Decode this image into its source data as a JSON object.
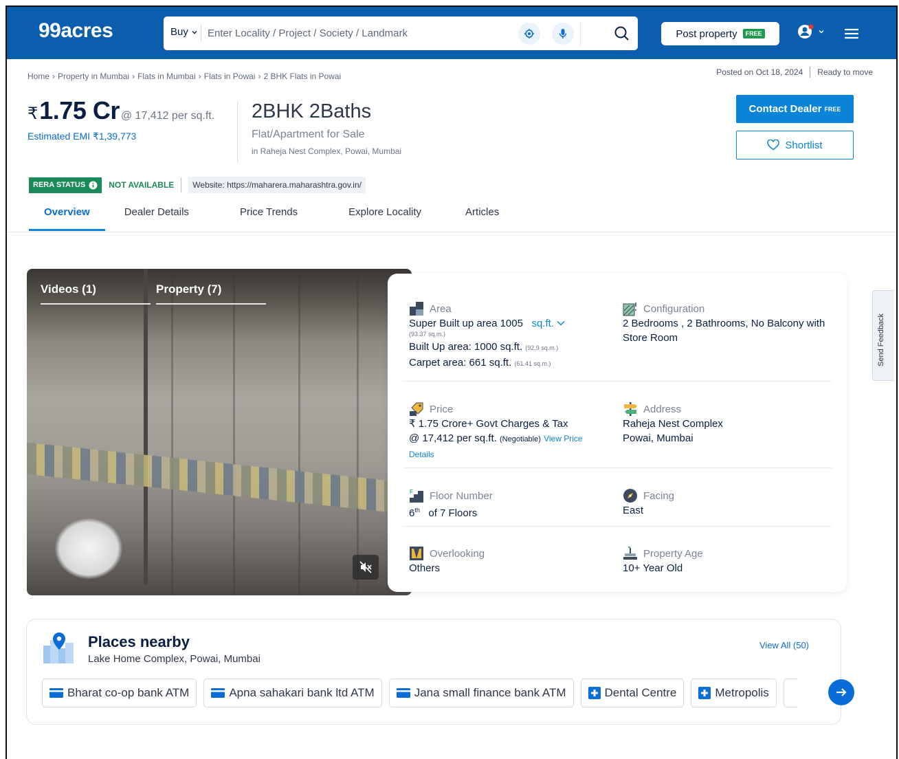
{
  "header": {
    "logo": "99acres",
    "buy_label": "Buy",
    "search_placeholder": "Enter Locality / Project / Society / Landmark",
    "post_property_label": "Post property",
    "post_property_tag": "FREE",
    "colors": {
      "brand": "#0a5ead",
      "accent": "#0a84d6",
      "green": "#1b8a5a"
    }
  },
  "breadcrumb": [
    "Home",
    "Property in Mumbai",
    "Flats in Mumbai",
    "Flats in Powai",
    "2 BHK Flats in Powai"
  ],
  "posted": {
    "date": "Posted on Oct 18, 2024",
    "status": "Ready to move"
  },
  "price": {
    "currency": "₹",
    "amount": "1.75 Cr",
    "per_sqft": "@ 17,412 per sq.ft.",
    "emi": "Estimated EMI ₹1,39,773"
  },
  "title": {
    "main": "2BHK 2Baths",
    "sub": "Flat/Apartment for Sale",
    "location": "in Raheja Nest Complex, Powai, Mumbai"
  },
  "actions": {
    "contact_label": "Contact Dealer",
    "contact_tag": "FREE",
    "shortlist_label": "Shortlist"
  },
  "rera": {
    "label": "RERA STATUS",
    "status": "NOT AVAILABLE",
    "website": "Website: https://maharera.maharashtra.gov.in/"
  },
  "tabs": [
    "Overview",
    "Dealer Details",
    "Price Trends",
    "Explore Locality",
    "Articles"
  ],
  "media": {
    "tabs": [
      "Videos (1)",
      "Property (7)"
    ]
  },
  "details": {
    "area": {
      "label": "Area",
      "super": "Super Built up area 1005",
      "unit": "sq.ft.",
      "super_sqm": "(93.37 sq.m.)",
      "built": "Built Up area: 1000 sq.ft.",
      "built_sqm": "(92.9 sq.m.)",
      "carpet": "Carpet area: 661 sq.ft.",
      "carpet_sqm": "(61.41 sq.m.)"
    },
    "configuration": {
      "label": "Configuration",
      "value": "2 Bedrooms , 2 Bathrooms, No Balcony with Store Room"
    },
    "price": {
      "label": "Price",
      "line1": "₹ 1.75 Crore+ Govt Charges & Tax",
      "line2": "@ 17,412 per sq.ft.",
      "negotiable": "(Negotiable)",
      "link": "View Price Details"
    },
    "address": {
      "label": "Address",
      "line1": "Raheja Nest Complex",
      "line2": "Powai, Mumbai"
    },
    "floor": {
      "label": "Floor Number",
      "num": "6",
      "suffix": "th",
      "rest": "of 7 Floors"
    },
    "facing": {
      "label": "Facing",
      "value": "East"
    },
    "overlooking": {
      "label": "Overlooking",
      "value": "Others"
    },
    "age": {
      "label": "Property Age",
      "value": "10+ Year Old"
    }
  },
  "feedback_label": "Send Feedback",
  "places": {
    "title": "Places nearby",
    "subtitle": "Lake Home Complex, Powai, Mumbai",
    "view_all": "View All (50)",
    "chips": [
      {
        "label": "Bharat co-op bank ATM",
        "icon": "atm-icon"
      },
      {
        "label": "Apna sahakari bank ltd ATM",
        "icon": "atm-icon"
      },
      {
        "label": "Jana small finance bank ATM",
        "icon": "atm-icon"
      },
      {
        "label": "Dental Centre",
        "icon": "hospital-icon"
      },
      {
        "label": "Metropolis",
        "icon": "hospital-icon"
      }
    ]
  }
}
